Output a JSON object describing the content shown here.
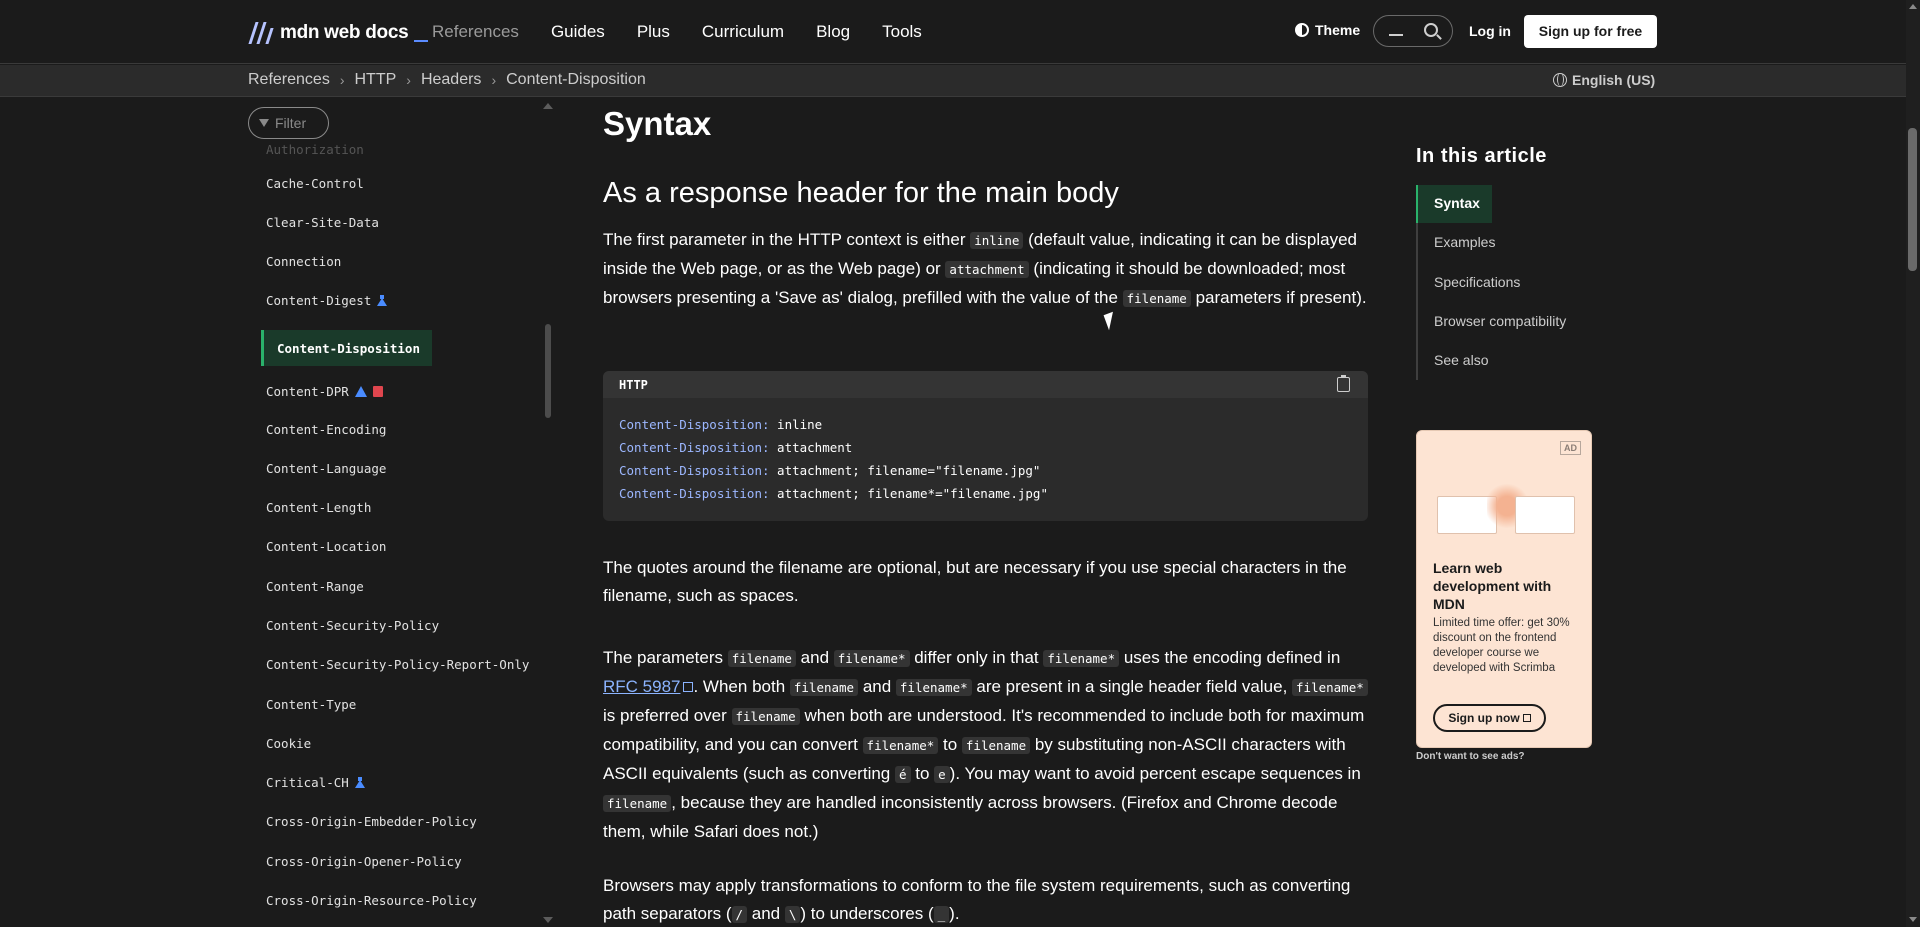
{
  "header": {
    "logo_text": "mdn web docs",
    "nav": [
      "References",
      "Guides",
      "Plus",
      "Curriculum",
      "Blog",
      "Tools"
    ],
    "theme_label": "Theme",
    "login_label": "Log in",
    "signup_label": "Sign up for free"
  },
  "breadcrumb": {
    "items": [
      "References",
      "HTTP",
      "Headers",
      "Content-Disposition"
    ],
    "language": "English (US)"
  },
  "sidebar": {
    "filter_placeholder": "Filter",
    "items": [
      {
        "label": "Authorization",
        "state": "faded"
      },
      {
        "label": "Cache-Control"
      },
      {
        "label": "Clear-Site-Data"
      },
      {
        "label": "Connection"
      },
      {
        "label": "Content-Digest",
        "icons": [
          "experimental-icon"
        ]
      },
      {
        "label": "Content-Disposition",
        "state": "active"
      },
      {
        "label": "Content-DPR",
        "icons": [
          "warning-icon",
          "deprecated-icon"
        ]
      },
      {
        "label": "Content-Encoding"
      },
      {
        "label": "Content-Language"
      },
      {
        "label": "Content-Length"
      },
      {
        "label": "Content-Location"
      },
      {
        "label": "Content-Range"
      },
      {
        "label": "Content-Security-Policy"
      },
      {
        "label": "Content-Security-Policy-Report-Only"
      },
      {
        "label": "Content-Type"
      },
      {
        "label": "Cookie"
      },
      {
        "label": "Critical-CH",
        "icons": [
          "experimental-icon"
        ]
      },
      {
        "label": "Cross-Origin-Embedder-Policy"
      },
      {
        "label": "Cross-Origin-Opener-Policy"
      },
      {
        "label": "Cross-Origin-Resource-Policy"
      }
    ]
  },
  "main": {
    "heading": "Syntax",
    "subheading": "As a response header for the main body",
    "p1": {
      "t1": "The first parameter in the HTTP context is either ",
      "c1": "inline",
      "t2": " (default value, indicating it can be displayed inside the Web page, or as the Web page) or ",
      "c2": "attachment",
      "t3": " (indicating it should be downloaded; most browsers presenting a 'Save as' dialog, prefilled with the value of the ",
      "c3": "filename",
      "t4": " parameters if present)."
    },
    "code": {
      "lang": "HTTP",
      "lines": [
        {
          "key": "Content-Disposition:",
          "value": " inline"
        },
        {
          "key": "Content-Disposition:",
          "value": " attachment"
        },
        {
          "key": "Content-Disposition:",
          "value": " attachment; filename=\"filename.jpg\""
        },
        {
          "key": "Content-Disposition:",
          "value": " attachment; filename*=\"filename.jpg\""
        }
      ]
    },
    "p2": "The quotes around the filename are optional, but are necessary if you use special characters in the filename, such as spaces.",
    "p3": {
      "t1": "The parameters ",
      "c1": "filename",
      "t2": " and ",
      "c2": "filename*",
      "t3": " differ only in that ",
      "c3": "filename*",
      "t4": " uses the encoding defined in ",
      "link": "RFC 5987",
      "t5": ". When both ",
      "c4": "filename",
      "t6": " and ",
      "c5": "filename*",
      "t7": " are present in a single header field value, ",
      "c6": "filename*",
      "t8": " is preferred over ",
      "c7": "filename",
      "t9": " when both are understood. It's recommended to include both for maximum compatibility, and you can convert ",
      "c8": "filename*",
      "t10": " to ",
      "c9": "filename",
      "t11": " by substituting non-ASCII characters with ASCII equivalents (such as converting ",
      "c10": "é",
      "t12": " to ",
      "c11": "e",
      "t13": "). You may want to avoid percent escape sequences in ",
      "c12": "filename",
      "t14": ", because they are handled inconsistently across browsers. (Firefox and Chrome decode them, while Safari does not.)"
    },
    "p4": {
      "t1": "Browsers may apply transformations to conform to the file system requirements, such as converting path separators (",
      "c1": "/",
      "t2": " and ",
      "c2": "\\",
      "t3": ") to underscores (",
      "c3": "_",
      "t4": ")."
    }
  },
  "toc": {
    "title": "In this article",
    "items": [
      "Syntax",
      "Examples",
      "Specifications",
      "Browser compatibility",
      "See also"
    ]
  },
  "ad": {
    "badge": "AD",
    "title": "Learn web development with MDN",
    "text": "Limited time offer: get 30% discount on the frontend developer course we developed with Scrimba",
    "button": "Sign up now",
    "no_ads": "Don't want to see ads?"
  }
}
